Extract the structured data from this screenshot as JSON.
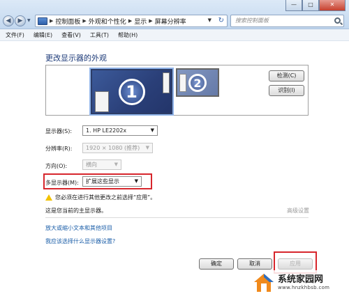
{
  "titlebar": {
    "breadcrumbs": [
      "控制面板",
      "外观和个性化",
      "显示",
      "屏幕分辨率"
    ],
    "search_placeholder": "搜索控制面板",
    "minimize": "—",
    "maximize": "□",
    "close": "✕"
  },
  "menu": [
    "文件(F)",
    "编辑(E)",
    "查看(V)",
    "工具(T)",
    "帮助(H)"
  ],
  "main": {
    "heading": "更改显示器的外观",
    "monitors": [
      "1",
      "2"
    ],
    "detect_button": "检测(C)",
    "identify_button": "识别(I)",
    "display_label": "显示器(S):",
    "display_value": "1. HP LE2202x",
    "resolution_label": "分辨率(R):",
    "resolution_value": "1920 × 1080 (推荐)",
    "orientation_label": "方向(O):",
    "orientation_value": "横向",
    "multi_display_label": "多显示器(M):",
    "multi_display_value": "扩展这些显示",
    "warning": "您必须在进行其他更改之前选择“应用”。",
    "primary_note": "这是您当前的主显示器。",
    "advanced_link": "高级设置",
    "link_text_size": "放大或缩小文本和其他项目",
    "link_help": "我应该选择什么显示器设置?"
  },
  "footer": {
    "ok": "确定",
    "cancel": "取消",
    "apply": "应用"
  },
  "watermark": {
    "title": "系统家园网",
    "url": "www.hnzkhbsb.com"
  },
  "colors": {
    "highlight": "#d7262c",
    "link": "#1b5ea8",
    "heading": "#1c3a78"
  }
}
